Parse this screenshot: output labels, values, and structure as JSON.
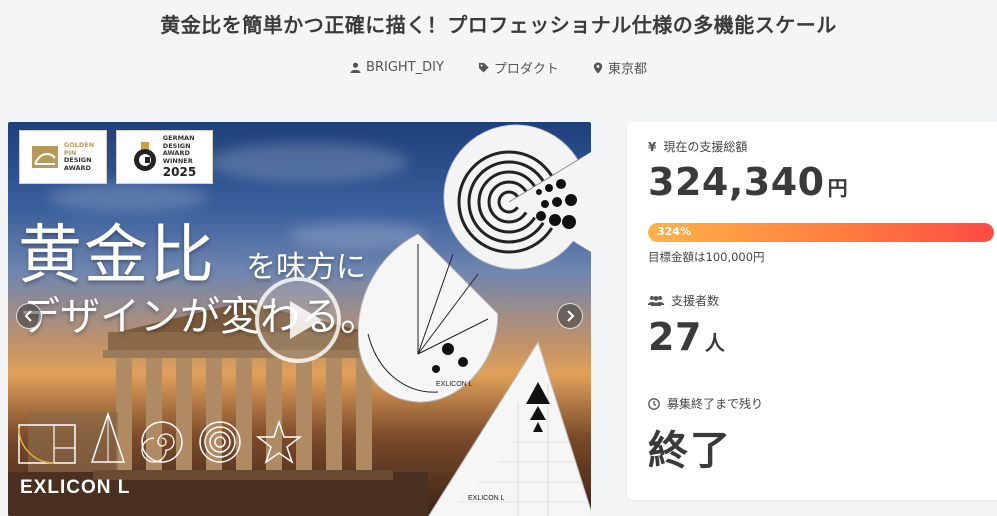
{
  "page": {
    "title": "黄金比を簡単かつ正確に描く！プロフェッショナル仕様の多機能スケール"
  },
  "meta": {
    "owner": "BRIGHT_DIY",
    "category": "プロダクト",
    "location": "東京都"
  },
  "hero": {
    "award_1": [
      "GOLDEN",
      "PIN",
      "DESIGN",
      "AWARD"
    ],
    "award_2": [
      "GERMAN",
      "DESIGN",
      "AWARD",
      "WINNER"
    ],
    "award_2_year": "2025",
    "headline_big": "黄金比",
    "headline_side": "を味方に",
    "headline_2": "デザインが変わる。",
    "brand": "EXLICON L",
    "scale_brand": "EXLICON L"
  },
  "funding": {
    "raised_label": "現在の支援総額",
    "raised_value": "324,340",
    "raised_unit": "円",
    "progress_text": "324%",
    "progress_fraction": 1.0,
    "goal_text": "目標金額は100,000円",
    "backers_label": "支援者数",
    "backers_value": "27",
    "backers_unit": "人",
    "remaining_label": "募集終了まで残り",
    "remaining_value": "終了"
  },
  "colors": {
    "progress_start": "#ffb24a",
    "progress_end": "#ff4a45",
    "background": "#f4f5f7"
  }
}
